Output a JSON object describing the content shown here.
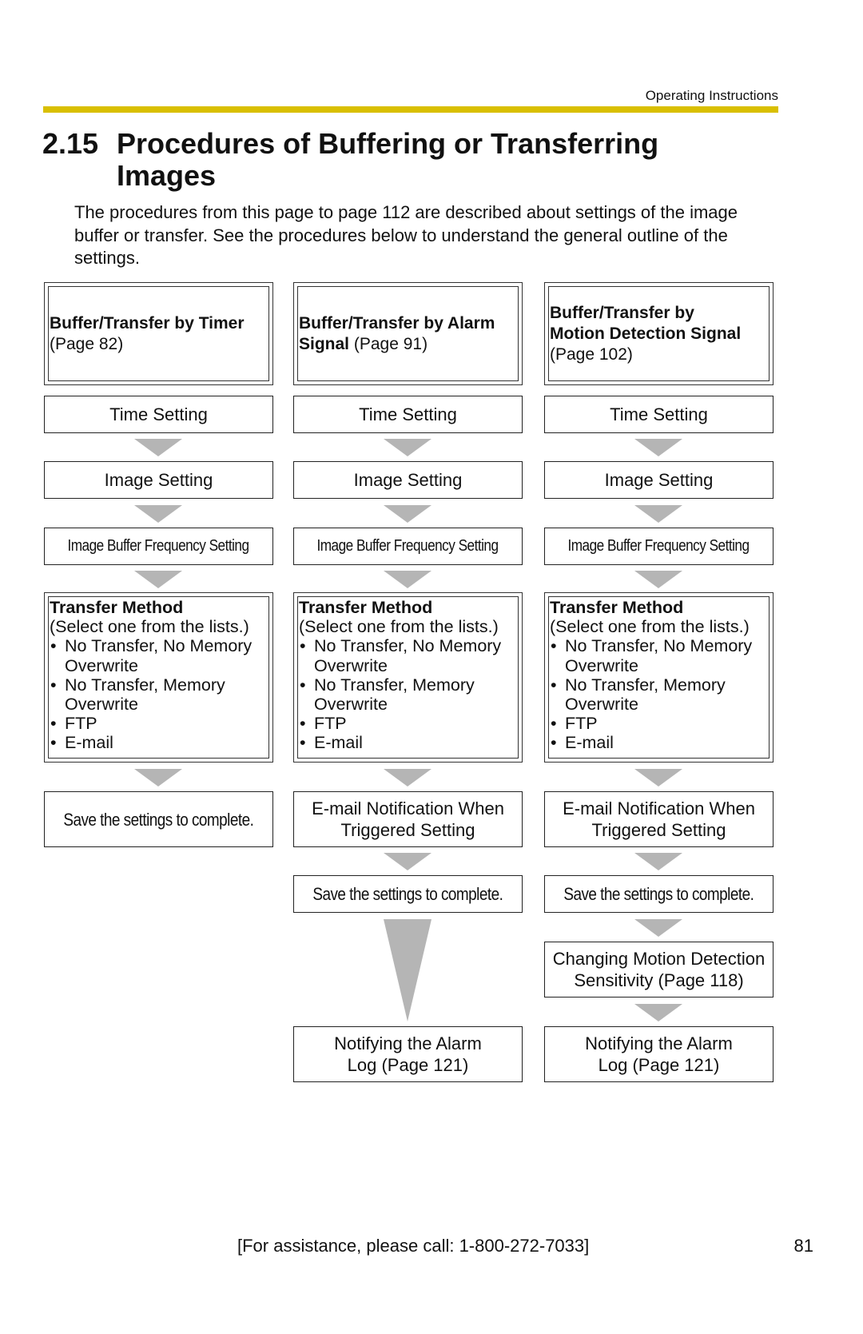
{
  "running_head": "Operating Instructions",
  "accent_color": "#d9bf00",
  "heading": {
    "number": "2.15",
    "title_line1": "Procedures of Buffering or Transferring",
    "title_line2": "Images"
  },
  "intro": "The procedures from this page to page 112 are described about settings of the image buffer or transfer. See the procedures below to understand the general outline of the settings.",
  "columns": [
    {
      "header_bold": "Buffer/Transfer by Timer",
      "header_page": "(Page 82)",
      "steps": {
        "time": "Time Setting",
        "image": "Image Setting",
        "buffer_freq": "Image Buffer Frequency Setting"
      },
      "transfer": {
        "title": "Transfer Method",
        "subtitle": "(Select one from the lists.)",
        "options": [
          "No Transfer, No Memory Overwrite",
          "No Transfer, Memory Overwrite",
          "FTP",
          "E-mail"
        ]
      },
      "after": [
        "Save the settings to complete."
      ]
    },
    {
      "header_bold_1": "Buffer/Transfer by Alarm",
      "header_bold_2": "Signal",
      "header_page": "(Page 91)",
      "steps": {
        "time": "Time Setting",
        "image": "Image Setting",
        "buffer_freq": "Image Buffer Frequency Setting"
      },
      "transfer": {
        "title": "Transfer Method",
        "subtitle": "(Select one from the lists.)",
        "options": [
          "No Transfer, No Memory Overwrite",
          "No Transfer, Memory Overwrite",
          "FTP",
          "E-mail"
        ]
      },
      "after": [
        "E-mail Notification When Triggered Setting",
        "Save the settings to complete.",
        "Notifying the Alarm Log (Page 121)"
      ]
    },
    {
      "header_bold_1": "Buffer/Transfer by",
      "header_bold_2": "Motion Detection Signal",
      "header_page": "(Page 102)",
      "steps": {
        "time": "Time Setting",
        "image": "Image Setting",
        "buffer_freq": "Image Buffer Frequency Setting"
      },
      "transfer": {
        "title": "Transfer Method",
        "subtitle": "(Select one from the lists.)",
        "options": [
          "No Transfer, No Memory Overwrite",
          "No Transfer, Memory Overwrite",
          "FTP",
          "E-mail"
        ]
      },
      "after": [
        "E-mail Notification When Triggered Setting",
        "Save the settings to complete.",
        "Changing Motion Detection Sensitivity (Page 118)",
        "Notifying the Alarm Log (Page 121)"
      ]
    }
  ],
  "footer": "[For assistance, please call: 1-800-272-7033]",
  "page_number": "81"
}
